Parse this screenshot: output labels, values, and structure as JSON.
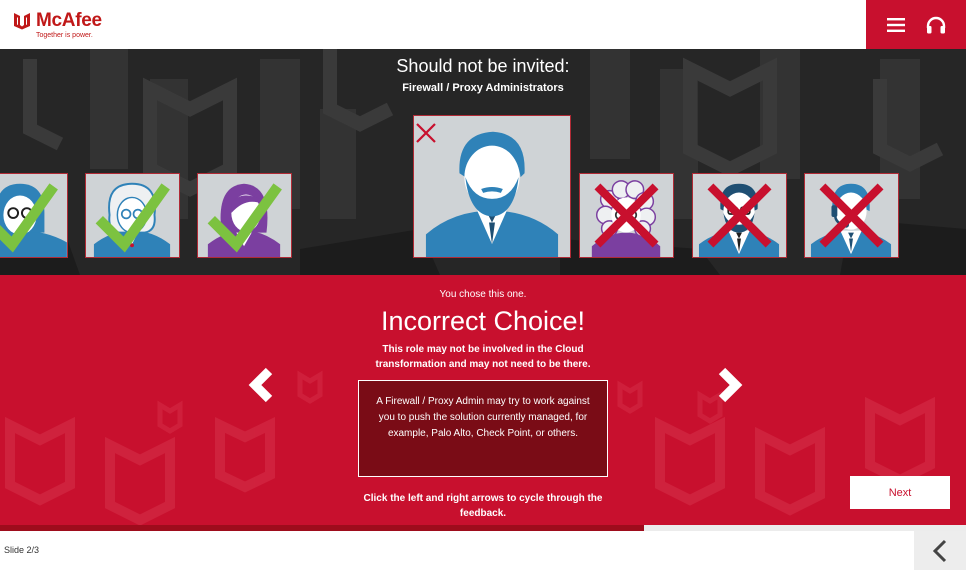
{
  "header": {
    "brand": "McAfee",
    "tagline": "Together is power.",
    "menu_icon": "hamburger-menu-icon",
    "audio_icon": "headphones-icon",
    "accent_color": "#c8102e"
  },
  "stage": {
    "heading": "Should not be invited:",
    "subheading": "Firewall / Proxy Administrators",
    "cards": [
      {
        "role": "glasses-woman-avatar",
        "mark": "check"
      },
      {
        "role": "older-woman-avatar",
        "mark": "check"
      },
      {
        "role": "purple-woman-avatar",
        "mark": "check"
      },
      {
        "role": "bearded-man-avatar",
        "mark": "cross",
        "selected": true
      },
      {
        "role": "curly-hair-woman-avatar",
        "mark": "cross"
      },
      {
        "role": "glasses-beard-man-avatar",
        "mark": "cross"
      },
      {
        "role": "headset-man-avatar",
        "mark": "cross"
      }
    ]
  },
  "feedback": {
    "chosen_text": "You chose this one.",
    "title": "Incorrect Choice!",
    "subtitle": "This role may not be involved in the Cloud transformation and may not need to be there.",
    "detail": "A Firewall / Proxy Admin may try to work against you to push the solution currently managed, for example, Palo Alto, Check Point, or others.",
    "hint": "Click the left and right arrows to cycle through the feedback.",
    "next_label": "Next",
    "prev_icon": "chevron-left-icon",
    "next_icon": "chevron-right-icon"
  },
  "progress": {
    "fraction": 0.667
  },
  "footer": {
    "slide_label": "Slide 2/3",
    "back_icon": "chevron-left-icon"
  }
}
